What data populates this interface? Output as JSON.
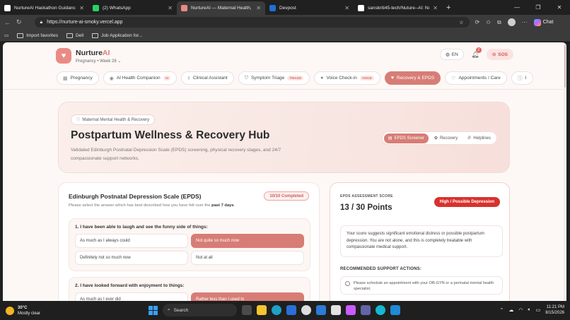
{
  "browser": {
    "tabs": [
      {
        "label": "NurtureAI Hackathon Guidance",
        "color": "#ffffff",
        "active": false
      },
      {
        "label": "(2) WhatsApp",
        "color": "#25d366",
        "active": false
      },
      {
        "label": "NurtureAI — Maternal Health, Fet",
        "color": "#e98b84",
        "active": true
      },
      {
        "label": "Devpost",
        "color": "#1f6fd6",
        "active": false
      },
      {
        "label": "sanskriti45-tech/Nuture--AI: Nurtu",
        "color": "#ffffff",
        "active": false
      }
    ],
    "url": "https://nurture-ai-smoky.vercel.app",
    "chat_label": "Chat",
    "favorites": [
      {
        "label": "Import favorites"
      },
      {
        "label": "Dell"
      },
      {
        "label": "Job Application for..."
      }
    ]
  },
  "app": {
    "brand_main": "Nurture",
    "brand_ai": "AI",
    "subtitle": "Pregnancy • Week 28",
    "lang": "EN",
    "notif_count": "2",
    "sos": "SOS",
    "nav": [
      {
        "label": "Pregnancy",
        "icon": "grid-icon",
        "glyph": "▦",
        "tag": "",
        "active": false
      },
      {
        "label": "AI Health Companion",
        "icon": "robot-icon",
        "glyph": "◉",
        "tag": "AI",
        "active": false
      },
      {
        "label": "Clinical Assistant",
        "icon": "stethoscope-icon",
        "glyph": "⚕",
        "tag": "",
        "active": false
      },
      {
        "label": "Symptom Triage",
        "icon": "shield-icon",
        "glyph": "⛉",
        "tag": "TRIAGE",
        "active": false
      },
      {
        "label": "Voice Check-in",
        "icon": "mic-icon",
        "glyph": "●",
        "tag": "VOICE",
        "active": false
      },
      {
        "label": "Recovery & EPDS",
        "icon": "heart-icon",
        "glyph": "♥",
        "tag": "",
        "active": true
      },
      {
        "label": "Appointments / Care",
        "icon": "heart-hand-icon",
        "glyph": "♡",
        "tag": "",
        "active": false
      },
      {
        "label": "I",
        "icon": "info-icon",
        "glyph": "ⓘ",
        "tag": "",
        "active": false
      }
    ]
  },
  "hero": {
    "tag": "Maternal Mental Health & Recovery",
    "title": "Postpartum Wellness & Recovery Hub",
    "desc": "Validated Edinburgh Postnatal Depression Scale (EPDS) screening, physical recovery stages, and 24/7 compassionate support networks.",
    "segments": [
      {
        "label": "EPDS Screener",
        "icon": "clipboard-icon",
        "glyph": "▤",
        "active": true
      },
      {
        "label": "Recovery",
        "icon": "sprout-icon",
        "glyph": "✿",
        "active": false
      },
      {
        "label": "Helplines",
        "icon": "phone-icon",
        "glyph": "✆",
        "active": false
      }
    ]
  },
  "epds": {
    "title": "Edinburgh Postnatal Depression Scale (EPDS)",
    "sub_before": "Please select the answer which has best described how you have felt over the ",
    "sub_bold": "past 7 days",
    "sub_after": ".",
    "completed": "10/10 Completed",
    "questions": [
      {
        "text": "1. I have been able to laugh and see the funny side of things:",
        "options": [
          {
            "label": "As much as I always could",
            "selected": false
          },
          {
            "label": "Not quite so much now",
            "selected": true
          },
          {
            "label": "Definitely not so much now",
            "selected": false
          },
          {
            "label": "Not at all",
            "selected": false
          }
        ]
      },
      {
        "text": "2. I have looked forward with enjoyment to things:",
        "options": [
          {
            "label": "As much as I ever did",
            "selected": false
          },
          {
            "label": "Rather less than I used to",
            "selected": true
          }
        ]
      }
    ]
  },
  "score": {
    "label": "EPDS ASSESSMENT SCORE",
    "value": "13 / 30 Points",
    "risk": "High / Possible Depression",
    "message": "Your score suggests significant emotional distress or possible postpartum depression. You are not alone, and this is completely treatable with compassionate medical support.",
    "rec_title": "RECOMMENDED SUPPORT ACTIONS:",
    "rec_item": "Please schedule an appointment with your OB-GYN or a perinatal mental health specialist."
  },
  "taskbar": {
    "temp": "30°C",
    "weather": "Mostly clear",
    "search": "Search",
    "time": "11:21 PM",
    "date": "8/15/2026"
  }
}
